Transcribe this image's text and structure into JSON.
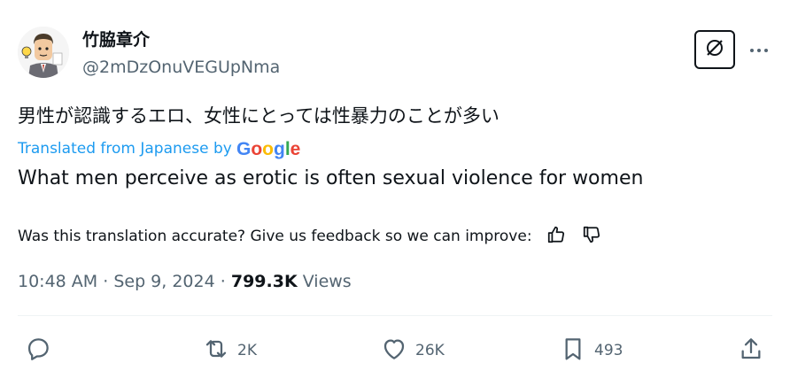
{
  "tweet": {
    "display_name": "竹脇章介",
    "handle": "@2mDzOnuVEGUpNma",
    "original_text": "男性が認識するエロ、女性にとっては性暴力のことが多い",
    "translated_label": "Translated from Japanese by",
    "translation_provider": "Google",
    "translated_text": "What men perceive as erotic is often sexual violence for women",
    "feedback_prompt": "Was this translation accurate? Give us feedback so we can improve:",
    "time": "10:48 AM",
    "date": "Sep 9, 2024",
    "views_count": "799.3K",
    "views_label": "Views",
    "separator": "·"
  },
  "actions": {
    "replies": "",
    "retweets": "2K",
    "likes": "26K",
    "bookmarks": "493"
  },
  "icons": {
    "grok": "grok-icon",
    "more": "more-icon",
    "reply": "reply-icon",
    "retweet": "retweet-icon",
    "like": "heart-icon",
    "bookmark": "bookmark-icon",
    "share": "share-icon",
    "thumbs_up": "thumbs-up-icon",
    "thumbs_down": "thumbs-down-icon"
  },
  "colors": {
    "text": "#0f1419",
    "secondary": "#536471",
    "link": "#1d9bf0",
    "divider": "#eff3f4"
  }
}
